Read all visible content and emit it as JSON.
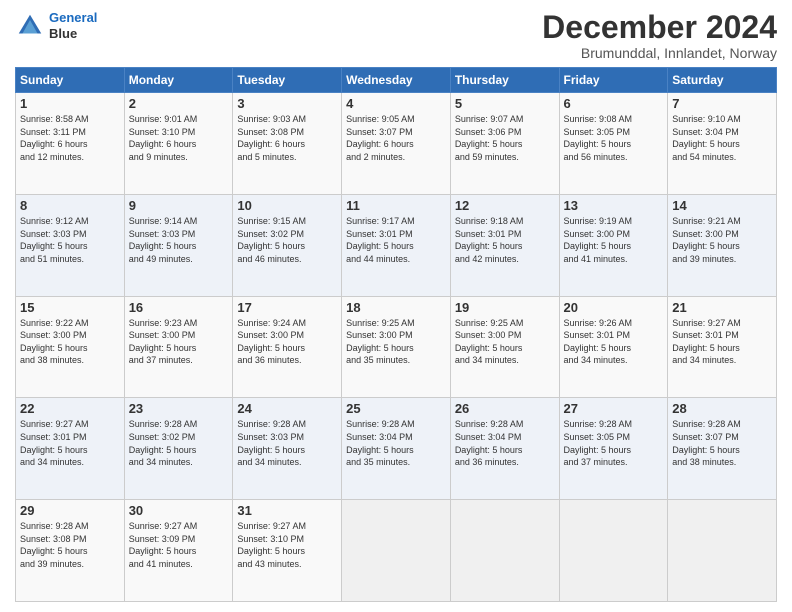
{
  "header": {
    "logo_line1": "General",
    "logo_line2": "Blue",
    "month": "December 2024",
    "location": "Brumunddal, Innlandet, Norway"
  },
  "days_of_week": [
    "Sunday",
    "Monday",
    "Tuesday",
    "Wednesday",
    "Thursday",
    "Friday",
    "Saturday"
  ],
  "weeks": [
    [
      {
        "day": "1",
        "info": "Sunrise: 8:58 AM\nSunset: 3:11 PM\nDaylight: 6 hours\nand 12 minutes."
      },
      {
        "day": "2",
        "info": "Sunrise: 9:01 AM\nSunset: 3:10 PM\nDaylight: 6 hours\nand 9 minutes."
      },
      {
        "day": "3",
        "info": "Sunrise: 9:03 AM\nSunset: 3:08 PM\nDaylight: 6 hours\nand 5 minutes."
      },
      {
        "day": "4",
        "info": "Sunrise: 9:05 AM\nSunset: 3:07 PM\nDaylight: 6 hours\nand 2 minutes."
      },
      {
        "day": "5",
        "info": "Sunrise: 9:07 AM\nSunset: 3:06 PM\nDaylight: 5 hours\nand 59 minutes."
      },
      {
        "day": "6",
        "info": "Sunrise: 9:08 AM\nSunset: 3:05 PM\nDaylight: 5 hours\nand 56 minutes."
      },
      {
        "day": "7",
        "info": "Sunrise: 9:10 AM\nSunset: 3:04 PM\nDaylight: 5 hours\nand 54 minutes."
      }
    ],
    [
      {
        "day": "8",
        "info": "Sunrise: 9:12 AM\nSunset: 3:03 PM\nDaylight: 5 hours\nand 51 minutes."
      },
      {
        "day": "9",
        "info": "Sunrise: 9:14 AM\nSunset: 3:03 PM\nDaylight: 5 hours\nand 49 minutes."
      },
      {
        "day": "10",
        "info": "Sunrise: 9:15 AM\nSunset: 3:02 PM\nDaylight: 5 hours\nand 46 minutes."
      },
      {
        "day": "11",
        "info": "Sunrise: 9:17 AM\nSunset: 3:01 PM\nDaylight: 5 hours\nand 44 minutes."
      },
      {
        "day": "12",
        "info": "Sunrise: 9:18 AM\nSunset: 3:01 PM\nDaylight: 5 hours\nand 42 minutes."
      },
      {
        "day": "13",
        "info": "Sunrise: 9:19 AM\nSunset: 3:00 PM\nDaylight: 5 hours\nand 41 minutes."
      },
      {
        "day": "14",
        "info": "Sunrise: 9:21 AM\nSunset: 3:00 PM\nDaylight: 5 hours\nand 39 minutes."
      }
    ],
    [
      {
        "day": "15",
        "info": "Sunrise: 9:22 AM\nSunset: 3:00 PM\nDaylight: 5 hours\nand 38 minutes."
      },
      {
        "day": "16",
        "info": "Sunrise: 9:23 AM\nSunset: 3:00 PM\nDaylight: 5 hours\nand 37 minutes."
      },
      {
        "day": "17",
        "info": "Sunrise: 9:24 AM\nSunset: 3:00 PM\nDaylight: 5 hours\nand 36 minutes."
      },
      {
        "day": "18",
        "info": "Sunrise: 9:25 AM\nSunset: 3:00 PM\nDaylight: 5 hours\nand 35 minutes."
      },
      {
        "day": "19",
        "info": "Sunrise: 9:25 AM\nSunset: 3:00 PM\nDaylight: 5 hours\nand 34 minutes."
      },
      {
        "day": "20",
        "info": "Sunrise: 9:26 AM\nSunset: 3:01 PM\nDaylight: 5 hours\nand 34 minutes."
      },
      {
        "day": "21",
        "info": "Sunrise: 9:27 AM\nSunset: 3:01 PM\nDaylight: 5 hours\nand 34 minutes."
      }
    ],
    [
      {
        "day": "22",
        "info": "Sunrise: 9:27 AM\nSunset: 3:01 PM\nDaylight: 5 hours\nand 34 minutes."
      },
      {
        "day": "23",
        "info": "Sunrise: 9:28 AM\nSunset: 3:02 PM\nDaylight: 5 hours\nand 34 minutes."
      },
      {
        "day": "24",
        "info": "Sunrise: 9:28 AM\nSunset: 3:03 PM\nDaylight: 5 hours\nand 34 minutes."
      },
      {
        "day": "25",
        "info": "Sunrise: 9:28 AM\nSunset: 3:04 PM\nDaylight: 5 hours\nand 35 minutes."
      },
      {
        "day": "26",
        "info": "Sunrise: 9:28 AM\nSunset: 3:04 PM\nDaylight: 5 hours\nand 36 minutes."
      },
      {
        "day": "27",
        "info": "Sunrise: 9:28 AM\nSunset: 3:05 PM\nDaylight: 5 hours\nand 37 minutes."
      },
      {
        "day": "28",
        "info": "Sunrise: 9:28 AM\nSunset: 3:07 PM\nDaylight: 5 hours\nand 38 minutes."
      }
    ],
    [
      {
        "day": "29",
        "info": "Sunrise: 9:28 AM\nSunset: 3:08 PM\nDaylight: 5 hours\nand 39 minutes."
      },
      {
        "day": "30",
        "info": "Sunrise: 9:27 AM\nSunset: 3:09 PM\nDaylight: 5 hours\nand 41 minutes."
      },
      {
        "day": "31",
        "info": "Sunrise: 9:27 AM\nSunset: 3:10 PM\nDaylight: 5 hours\nand 43 minutes."
      },
      {
        "day": "",
        "info": ""
      },
      {
        "day": "",
        "info": ""
      },
      {
        "day": "",
        "info": ""
      },
      {
        "day": "",
        "info": ""
      }
    ]
  ]
}
